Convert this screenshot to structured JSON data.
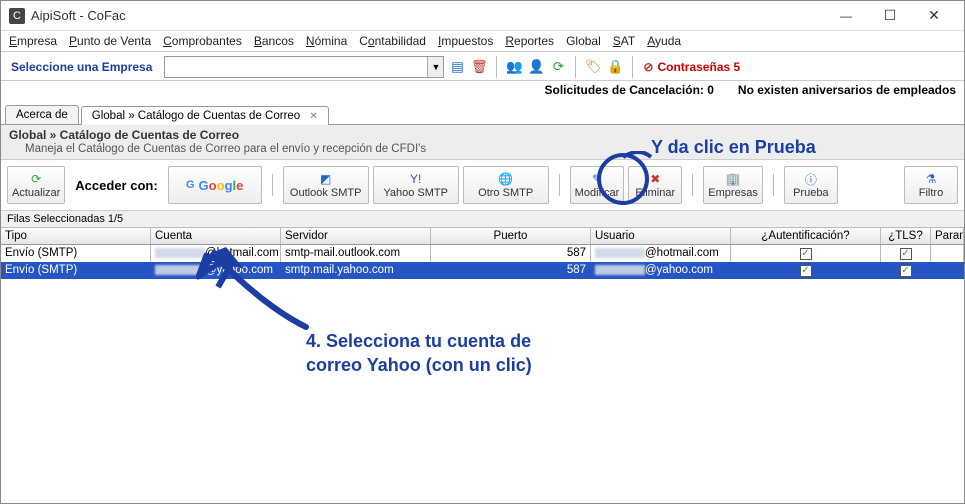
{
  "window": {
    "title": "AipiSoft - CoFac"
  },
  "menu": {
    "empresa": "Empresa",
    "pdv": "Punto de Venta",
    "comprobantes": "Comprobantes",
    "bancos": "Bancos",
    "nomina": "Nómina",
    "contabilidad": "Contabilidad",
    "impuestos": "Impuestos",
    "reportes": "Reportes",
    "global": "Global",
    "sat": "SAT",
    "ayuda": "Ayuda"
  },
  "top": {
    "select_empresa": "Seleccione una Empresa",
    "contrasenas": "Contraseñas 5",
    "solic": "Solicitudes de Cancelación:  0",
    "anniv": "No existen aniversarios de empleados"
  },
  "tabs": {
    "acerca": "Acerca de",
    "active": "Global » Catálogo de Cuentas de Correo"
  },
  "header": {
    "h1": "Global » Catálogo de Cuentas de Correo",
    "h2": "Maneja el Catálogo de Cuentas de Correo para el envío y recepción de CFDI's"
  },
  "toolbar": {
    "actualizar": "Actualizar",
    "acceder": "Acceder con:",
    "google": "Google",
    "outlook": "Outlook SMTP",
    "yahoo": "Yahoo SMTP",
    "otro": "Otro SMTP",
    "modificar": "Modificar",
    "eliminar": "Eliminar",
    "empresas": "Empresas",
    "prueba": "Prueba",
    "filtro": "Filtro"
  },
  "grid": {
    "filas": "Filas Seleccionadas  1/5",
    "cols": {
      "tipo": "Tipo",
      "cuenta": "Cuenta",
      "servidor": "Servidor",
      "puerto": "Puerto",
      "usuario": "Usuario",
      "auth": "¿Autentificación?",
      "tls": "¿TLS?",
      "params": "Params"
    },
    "rows": [
      {
        "tipo": "Envío (SMTP)",
        "cuenta": "@hotmail.com",
        "servidor": "smtp-mail.outlook.com",
        "puerto": "587",
        "usuario": "@hotmail.com",
        "auth": true,
        "tls": true,
        "params": ""
      },
      {
        "tipo": "Envío (SMTP)",
        "cuenta": "@yahoo.com",
        "servidor": "smtp.mail.yahoo.com",
        "puerto": "587",
        "usuario": "@yahoo.com",
        "auth": true,
        "tls": true,
        "params": ""
      }
    ]
  },
  "annot": {
    "prueba": "Y da clic en Prueba",
    "sel": "4. Selecciona tu cuenta de correo Yahoo (con un clic)"
  }
}
